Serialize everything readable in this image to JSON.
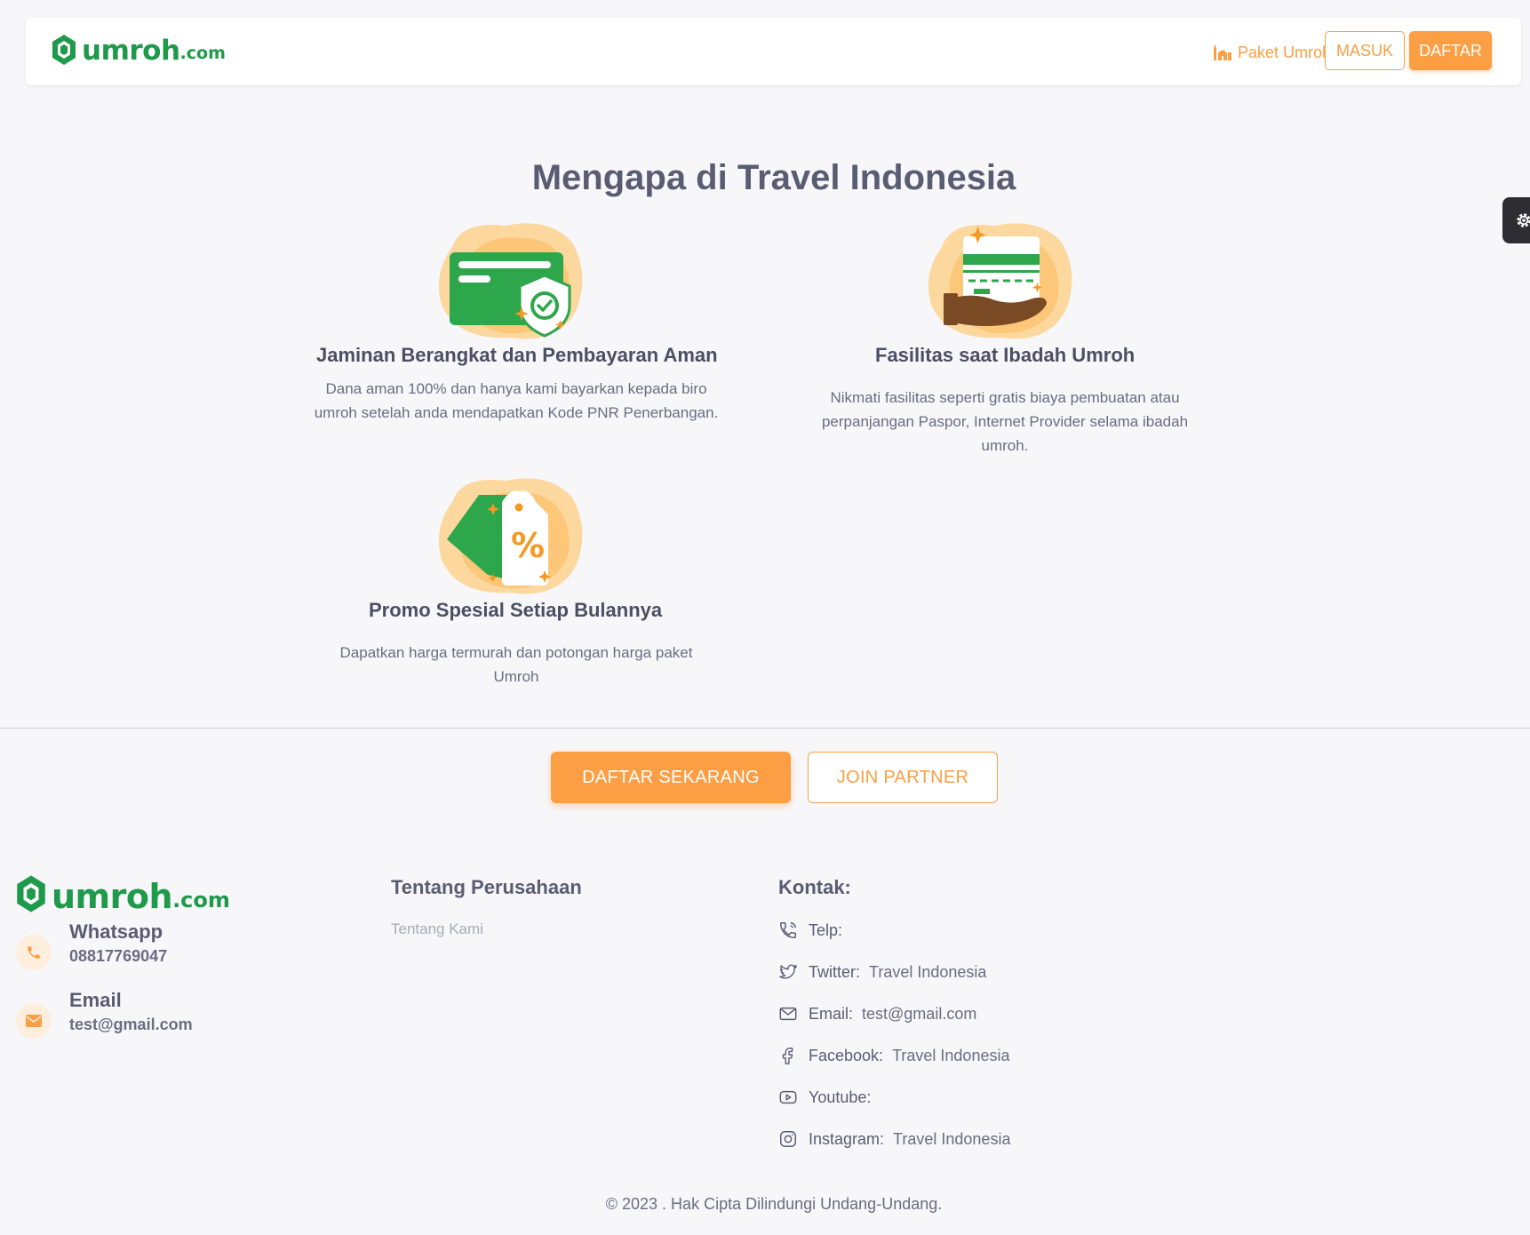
{
  "header": {
    "logo_word": "umroh",
    "logo_domain": ".com",
    "nav_paket": "Paket Umroh",
    "masuk": "MASUK",
    "daftar": "DAFTAR"
  },
  "section": {
    "title": "Mengapa di Travel Indonesia"
  },
  "features": [
    {
      "title": "Jaminan Berangkat dan Pembayaran Aman",
      "desc_1": "Dana aman 100% dan hanya kami bayarkan kepada biro",
      "desc_2": "umroh setelah anda mendapatkan Kode PNR Penerbangan."
    },
    {
      "title": "Fasilitas saat Ibadah Umroh",
      "desc_1": "Nikmati fasilitas seperti gratis biaya pembuatan atau",
      "desc_2": "perpanjangan Paspor, Internet Provider selama ibadah",
      "desc_3": "umroh."
    },
    {
      "title": "Promo Spesial Setiap Bulannya",
      "desc_1": "Dapatkan harga termurah dan potongan harga paket",
      "desc_2": "Umroh",
      "tag_symbol": "%"
    }
  ],
  "cta": {
    "primary": "DAFTAR SEKARANG",
    "secondary": "JOIN PARTNER"
  },
  "footer": {
    "logo_word": "umroh",
    "logo_domain": ".com",
    "whatsapp_title": "Whatsapp",
    "whatsapp_value": "08817769047",
    "email_title": "Email",
    "email_value": "test@gmail.com",
    "company_title": "Tentang Perusahaan",
    "about_link": "Tentang Kami",
    "contact_title": "Kontak:",
    "contacts": [
      {
        "label": "Telp:",
        "value": "",
        "icon": "phone-icon"
      },
      {
        "label": "Twitter:",
        "value": "Travel Indonesia",
        "icon": "twitter-icon"
      },
      {
        "label": "Email:",
        "value": "test@gmail.com",
        "icon": "mail-icon"
      },
      {
        "label": "Facebook:",
        "value": "Travel Indonesia",
        "icon": "facebook-icon"
      },
      {
        "label": "Youtube:",
        "value": "",
        "icon": "youtube-icon"
      },
      {
        "label": "Instagram:",
        "value": "Travel Indonesia",
        "icon": "instagram-icon"
      }
    ],
    "copyright": "© 2023 . Hak Cipta Dilindungi Undang-Undang."
  },
  "colors": {
    "brand_green": "#1f9a4a",
    "accent_orange": "#fb9e44",
    "text_dark": "#5a5c72",
    "background": "#f7f7fa"
  }
}
